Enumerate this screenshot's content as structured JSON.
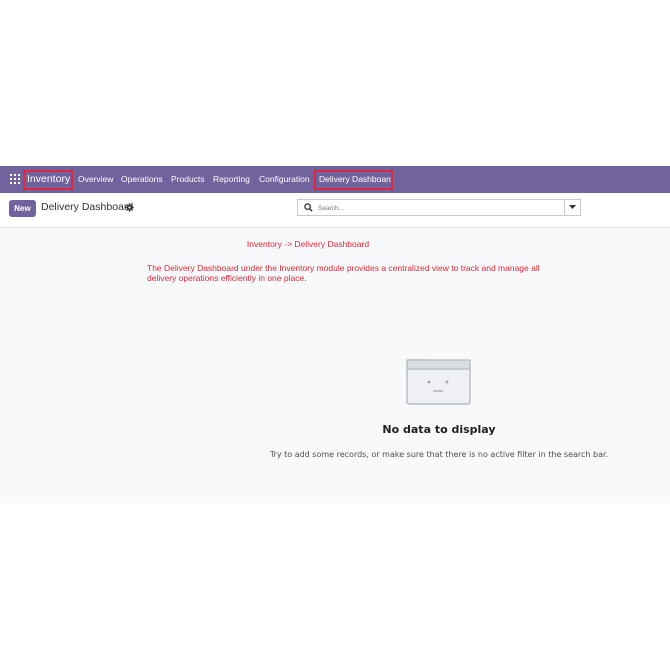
{
  "navbar": {
    "brand": "Inventory",
    "items": [
      "Overview",
      "Operations",
      "Products",
      "Reporting",
      "Configuration",
      "Delivery Dashboard"
    ]
  },
  "control": {
    "new_label": "New",
    "title": "Delivery Dashboard",
    "search_placeholder": "Search..."
  },
  "annotation": {
    "title": "Inventory -> Delivery Dashboard",
    "description": "The Delivery Dashboard under the Inventory module provides a centralized view to track and manage all delivery operations efficiently in one place."
  },
  "empty_state": {
    "title": "No data to display",
    "message": "Try to add some records, or make sure that there is no active filter in the search bar."
  },
  "colors": {
    "navbar": "#71639e",
    "annotation_red": "#e0263a",
    "content_bg": "#f8f9fa"
  },
  "icons": [
    "apps-grid-icon",
    "gear-icon",
    "search-icon",
    "caret-down-icon",
    "empty-folder-icon"
  ]
}
